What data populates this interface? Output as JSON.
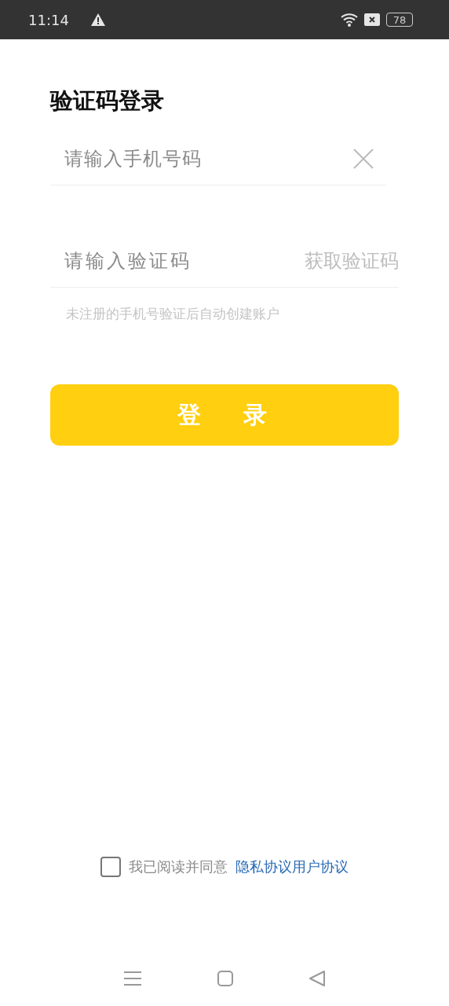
{
  "status_bar": {
    "time": "11:14",
    "battery": "78"
  },
  "title": "验证码登录",
  "phone_field": {
    "placeholder": "请输入手机号码"
  },
  "code_field": {
    "placeholder": "请输入验证码",
    "action": "获取验证码"
  },
  "hint": "未注册的手机号验证后自动创建账户",
  "login_button": "登录",
  "agreement": {
    "checked": false,
    "text": "我已阅读并同意",
    "links": [
      "隐私协议",
      "用户协议"
    ]
  }
}
